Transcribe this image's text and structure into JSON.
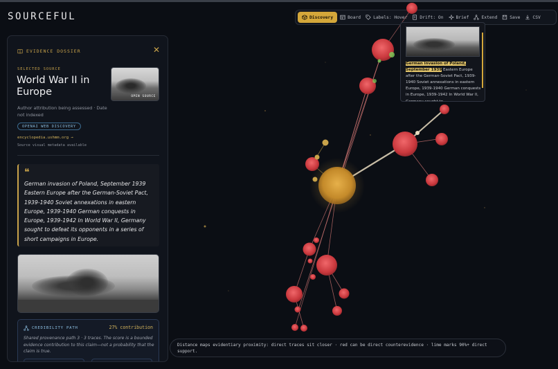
{
  "app": {
    "brand": "SOURCEFUL"
  },
  "toolbar": {
    "discovery": "Discovery",
    "board": "Board",
    "labels": "Labels: Hover",
    "drift": "Drift: On",
    "brief": "Brief",
    "extend": "Extend",
    "save": "Save",
    "csv": "CSV"
  },
  "dossier": {
    "heading": "EVIDENCE DOSSIER",
    "close": "✕",
    "selected_label": "SELECTED SOURCE",
    "title": "World War II in Europe",
    "thumb_tag": "OPEN SOURCE",
    "meta": "Author attribution being assessed · Date not indexed",
    "badge": "OPENAI WEB DISCOVERY",
    "link": "encyclopedia.ushmm.org →",
    "visual_meta": "Source visual metadata available",
    "quote_mark": "❝",
    "quote": "German invasion of Poland, September 1939 Eastern Europe after the German-Soviet Pact, 1939-1940 Soviet annexations in eastern Europe, 1939-1940 German conquests in Europe, 1939-1942 In World War II, Germany sought to defeat its opponents in a series of short campaigns in Europe.",
    "credibility": {
      "title": "CREDIBILITY PATH",
      "contribution": "27% contribution",
      "description": "Shared provenance path 3 · 3 traces. The score is a bounded evidence contribution to this claim—not a probability that the claim is true."
    }
  },
  "hover_card": {
    "highlight": "German invasion of Poland, September 1939",
    "rest": " Eastern Europe after the German-Soviet Pact, 1939-1940 Soviet annexations in eastern Europe, 1939-1940 German conquests in Europe, 1939-1942 In World War II, Germany sought to"
  },
  "legend": {
    "text": "Distance maps evidentiary proximity: direct traces sit closer · red can be direct counterevidence · lime marks 90%+ direct support."
  },
  "colors": {
    "accent": "#d4a73a",
    "counter": "#e0474c",
    "support": "#8bd65a",
    "background": "#0b0e14"
  }
}
